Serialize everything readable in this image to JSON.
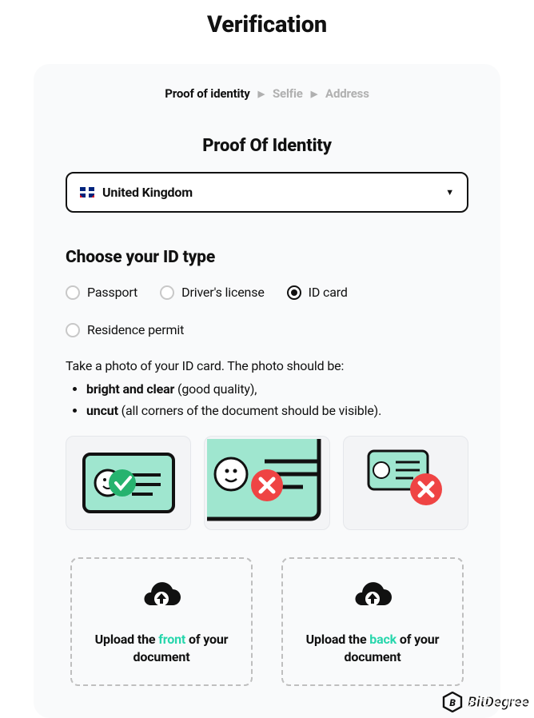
{
  "title": "Verification",
  "steps": [
    {
      "label": "Proof of identity",
      "active": true
    },
    {
      "label": "Selfie",
      "active": false
    },
    {
      "label": "Address",
      "active": false
    }
  ],
  "section_title": "Proof Of Identity",
  "country": {
    "name": "United Kingdom"
  },
  "choose_title": "Choose your ID type",
  "id_types": {
    "passport": "Passport",
    "drivers_license": "Driver's license",
    "id_card": "ID card",
    "residence_permit": "Residence permit",
    "selected": "id_card"
  },
  "instructions": {
    "intro": "Take a photo of your ID card. The photo should be:",
    "b1_strong": "bright and clear",
    "b1_rest": " (good quality),",
    "b2_strong": "uncut",
    "b2_rest": " (all corners of the document should be visible)."
  },
  "upload": {
    "front_pre": "Upload the ",
    "front_word": "front",
    "front_post": " of your document",
    "back_pre": "Upload the ",
    "back_word": "back",
    "back_post": " of your document"
  },
  "watermark": "BitDegree"
}
